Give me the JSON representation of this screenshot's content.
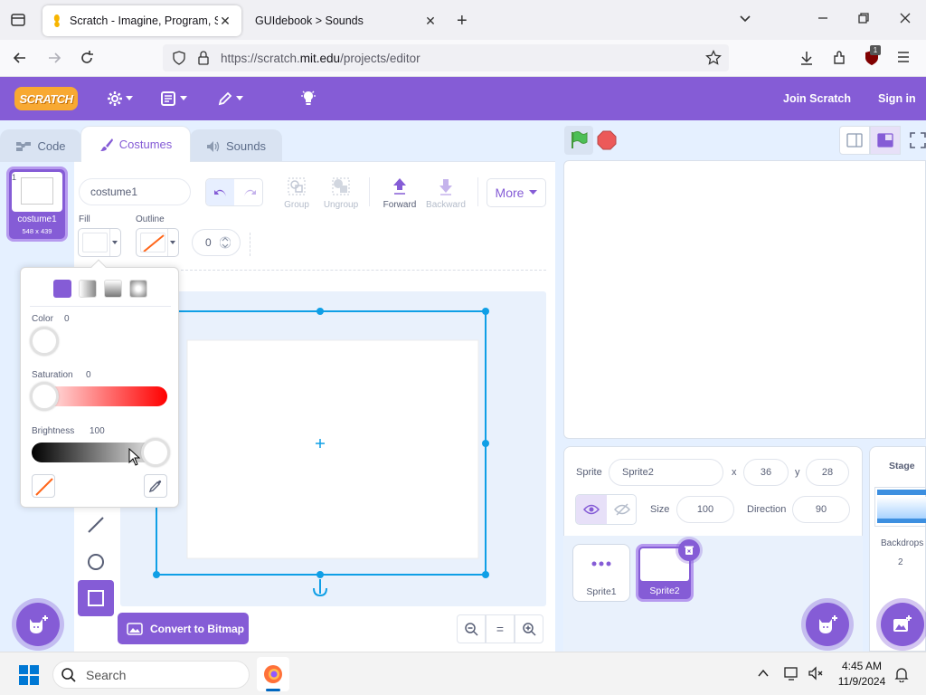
{
  "browser": {
    "tabs": [
      {
        "title": "Scratch - Imagine, Program, Sh",
        "active": true
      },
      {
        "title": "GUIdebook > Sounds",
        "active": false
      }
    ],
    "url_prefix": "https://scratch.",
    "url_domain": "mit.edu",
    "url_path": "/projects/editor",
    "notification_badge": "1"
  },
  "menubar": {
    "logo_text": "SCRATCH",
    "join": "Join Scratch",
    "signin": "Sign in"
  },
  "editor_tabs": {
    "code": "Code",
    "costumes": "Costumes",
    "sounds": "Sounds"
  },
  "costume_list": {
    "number": "1",
    "name": "costume1",
    "size": "548 x 439"
  },
  "paint": {
    "costume_name": "costume1",
    "fill_label": "Fill",
    "outline_label": "Outline",
    "outline_width": "0",
    "group": "Group",
    "ungroup": "Ungroup",
    "forward": "Forward",
    "backward": "Backward",
    "more": "More",
    "convert": "Convert to Bitmap",
    "zoom_reset": "="
  },
  "color_popover": {
    "color_label": "Color",
    "color_value": "0",
    "saturation_label": "Saturation",
    "saturation_value": "0",
    "brightness_label": "Brightness",
    "brightness_value": "100"
  },
  "sprite_info": {
    "sprite_label": "Sprite",
    "sprite_name": "Sprite2",
    "x_label": "x",
    "x": "36",
    "y_label": "y",
    "y": "28",
    "size_label": "Size",
    "size": "100",
    "direction_label": "Direction",
    "direction": "90"
  },
  "sprites": [
    {
      "name": "Sprite1",
      "selected": false
    },
    {
      "name": "Sprite2",
      "selected": true
    }
  ],
  "stage_panel": {
    "title": "Stage",
    "backdrops_label": "Backdrops",
    "backdrops_count": "2"
  },
  "taskbar": {
    "search": "Search",
    "time": "4:45 AM",
    "date": "11/9/2024"
  },
  "colors": {
    "scratch_purple": "#855cd6",
    "selection_blue": "#0f9fe6",
    "green_flag": "#4cbf56",
    "stop_red": "#ec5959"
  }
}
